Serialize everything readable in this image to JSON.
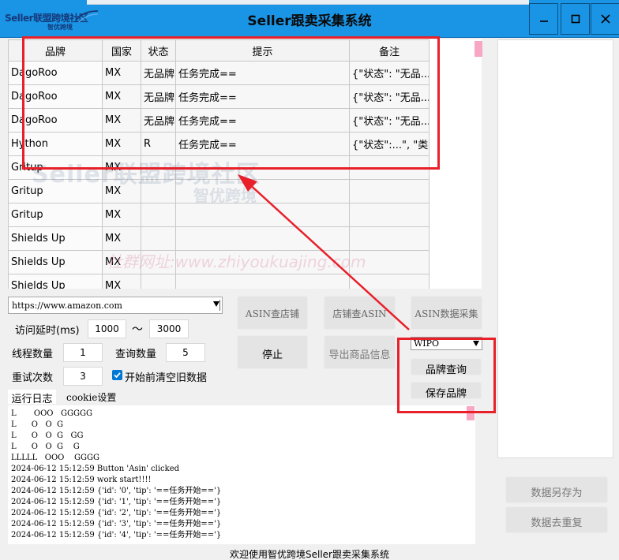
{
  "window": {
    "logo_text": "Seller联盟跨境社区",
    "logo_subtext": "智优跨境",
    "title": "Seller跟卖采集系统",
    "minimize_label": "—",
    "maximize_label": "☐",
    "close_label": "✕"
  },
  "table": {
    "columns": [
      "品牌",
      "国家",
      "状态",
      "提示",
      "备注"
    ],
    "rows": [
      [
        "DagoRoo",
        "MX",
        "无品牌",
        "任务完成==",
        "{\"状态\": \"无品..."
      ],
      [
        "DagoRoo",
        "MX",
        "无品牌",
        "任务完成==",
        "{\"状态\": \"无品..."
      ],
      [
        "DagoRoo",
        "MX",
        "无品牌",
        "任务完成==",
        "{\"状态\": \"无品..."
      ],
      [
        "Hython",
        "MX",
        "R",
        "任务完成==",
        "{\"状态\":...\", \"类..."
      ],
      [
        "Gritup",
        "MX",
        "",
        "",
        ""
      ],
      [
        "Gritup",
        "MX",
        "",
        "",
        ""
      ],
      [
        "Gritup",
        "MX",
        "",
        "",
        ""
      ],
      [
        "Shields Up",
        "MX",
        "",
        "",
        ""
      ],
      [
        "Shields Up",
        "MX",
        "",
        "",
        ""
      ],
      [
        "Shields Up",
        "MX",
        "",
        "",
        ""
      ]
    ]
  },
  "watermarks": {
    "line1": "Seller联盟跨境社区",
    "line2": "智优跨境",
    "line3": "社群网址:www.zhiyoukuajing.com"
  },
  "controls": {
    "url": "https://www.amazon.com",
    "delay_label": "访问延时(ms)",
    "delay_min": "1000",
    "delay_sep": "～",
    "delay_max": "3000",
    "threads_label": "线程数量",
    "threads": "1",
    "query_count_label": "查询数量",
    "query_count": "5",
    "retry_label": "重试次数",
    "retry": "3",
    "clear_label": "开始前清空旧数据",
    "wipo": "WIPO"
  },
  "buttons": {
    "asin_store": "ASIN查店铺",
    "store_asin": "店铺查ASIN",
    "asin_collect": "ASIN数据采集",
    "stop": "停止",
    "export": "导出商品信息",
    "brand_query": "品牌查询",
    "save_brand": "保存品牌",
    "save_as": "数据另存为",
    "dedupe": "数据去重复"
  },
  "tabs": {
    "log": "运行日志",
    "cookie": "cookie设置"
  },
  "log_lines": [
    "L       OOO   GGGGG",
    "L      O   O  G",
    "L      O   O  G   GG",
    "L      O   O  G    G",
    "LLLLL   OOO    GGGG",
    "2024-06-12 15:12:59 Button 'Asin' clicked",
    "2024-06-12 15:12:59 work start!!!!",
    "2024-06-12 15:12:59 {'id': '0', 'tip': '==任务开始=='}",
    "2024-06-12 15:12:59 {'id': '1', 'tip': '==任务开始=='}",
    "2024-06-12 15:12:59 {'id': '2', 'tip': '==任务开始=='}",
    "2024-06-12 15:12:59 {'id': '3', 'tip': '==任务开始=='}",
    "2024-06-12 15:12:59 {'id': '4', 'tip': '==任务开始=='}"
  ],
  "status_bar": "欢迎使用智优跨境Seller跟卖采集系统",
  "colors": {
    "titlebar": "#1a95e6",
    "annotation": "#e8202a",
    "checkbox": "#0078d4",
    "scroll_thumb": "#f7a6c4"
  }
}
